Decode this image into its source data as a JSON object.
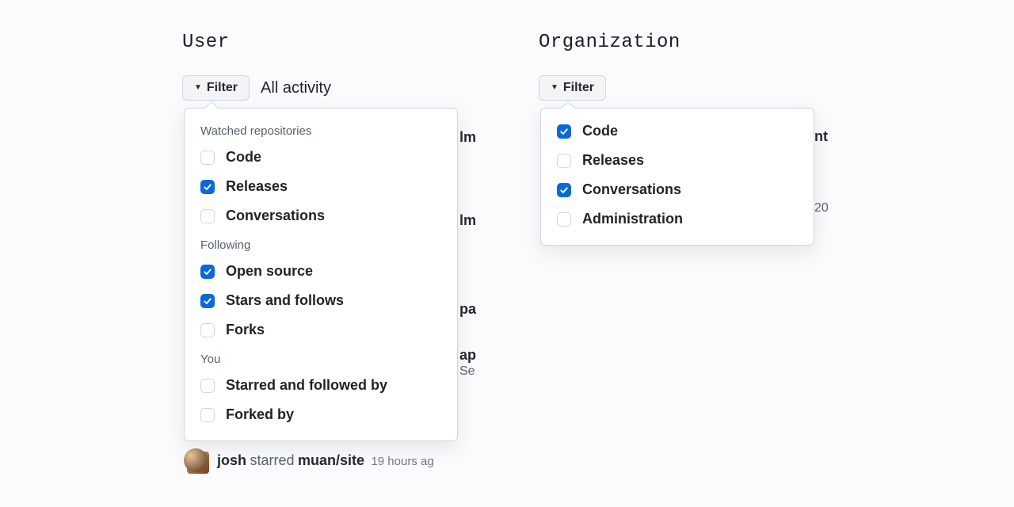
{
  "colors": {
    "accent": "#0969da"
  },
  "user": {
    "title": "User",
    "filter_button": "Filter",
    "activity_label": "All activity",
    "dropdown": {
      "groups": [
        {
          "label": "Watched repositories",
          "items": [
            {
              "label": "Code",
              "checked": false
            },
            {
              "label": "Releases",
              "checked": true
            },
            {
              "label": "Conversations",
              "checked": false
            }
          ]
        },
        {
          "label": "Following",
          "items": [
            {
              "label": "Open source",
              "checked": true
            },
            {
              "label": "Stars and follows",
              "checked": true
            },
            {
              "label": "Forks",
              "checked": false
            }
          ]
        },
        {
          "label": "You",
          "items": [
            {
              "label": "Starred and followed by",
              "checked": false
            },
            {
              "label": "Forked by",
              "checked": false
            }
          ]
        }
      ]
    },
    "feed_peek": {
      "fragments": [
        "lm",
        "lm",
        "pa",
        "ap",
        "Se"
      ],
      "bottom_row": {
        "user": "josh",
        "action": "starred",
        "repo": "muan/site",
        "time_ago": "19 hours ag"
      }
    }
  },
  "org": {
    "title": "Organization",
    "filter_button": "Filter",
    "dropdown": {
      "items": [
        {
          "label": "Code",
          "checked": true
        },
        {
          "label": "Releases",
          "checked": false
        },
        {
          "label": "Conversations",
          "checked": true
        },
        {
          "label": "Administration",
          "checked": false
        }
      ]
    },
    "feed_peek": {
      "fragments": [
        "nt",
        "20"
      ]
    }
  }
}
